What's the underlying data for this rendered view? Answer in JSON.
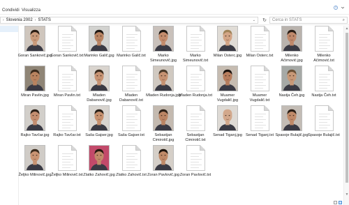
{
  "menu": {
    "share": "Condividi",
    "view": "Visualizza"
  },
  "address": {
    "crumbs": [
      "Slovenia 2002",
      "STATS"
    ],
    "search_placeholder": "Cerca in STATS"
  },
  "colors": {
    "accent": "#4a90d9",
    "selection": "#e5f0fb",
    "border": "#d9d9d9"
  },
  "icons": {
    "refresh": "refresh-icon",
    "search": "search-icon",
    "help": "help-icon",
    "collapse": "chevron-down-icon"
  },
  "files": [
    {
      "name": "Goran Sankovič.jpg",
      "type": "jpg",
      "skin": "#c99a7a",
      "hair": "#2b1d14",
      "bg": "#cfc6bd"
    },
    {
      "name": "Goran Sankovič.txt",
      "type": "txt"
    },
    {
      "name": "Marinko Galič.jpg",
      "type": "jpg",
      "skin": "#b98463",
      "hair": "#1f1712",
      "bg": "#d2d2cf"
    },
    {
      "name": "Marinko Galič.txt",
      "type": "txt"
    },
    {
      "name": "Marko Simeunovič.jpg",
      "type": "jpg",
      "skin": "#c48c6c",
      "hair": "#1b140f",
      "bg": "#c9c1bb"
    },
    {
      "name": "Marko Simeunovič.txt",
      "type": "txt"
    },
    {
      "name": "Milan Osterc.jpg",
      "type": "jpg",
      "skin": "#d3a586",
      "hair": "#a18459",
      "bg": "#e0dcd6"
    },
    {
      "name": "Milan Osterc.txt",
      "type": "txt"
    },
    {
      "name": "Milenko Ačimović.jpg",
      "type": "jpg",
      "skin": "#c0896b",
      "hair": "#2a1d15",
      "bg": "#b9b3ad"
    },
    {
      "name": "Milenko Ačimović.txt",
      "type": "txt"
    },
    {
      "name": "Miran Pavlin.jpg",
      "type": "jpg",
      "skin": "#b8835f",
      "hair": "#3a2a1c",
      "bg": "#8f8576"
    },
    {
      "name": "Miran Pavlin.txt",
      "type": "txt"
    },
    {
      "name": "Mladen Dabanovič.jpg",
      "type": "jpg",
      "skin": "#c79373",
      "hair": "#3b2b1e",
      "bg": "#d9d4ce"
    },
    {
      "name": "Mladen Dabanovič.txt",
      "type": "txt"
    },
    {
      "name": "Mladen Rudonja.jpg",
      "type": "jpg",
      "skin": "#c69272",
      "hair": "#4a3a2a",
      "bg": "#d0c9c1"
    },
    {
      "name": "Mladen Rudonja.txt",
      "type": "txt"
    },
    {
      "name": "Muamer Vugdalič.jpg",
      "type": "jpg",
      "skin": "#b77d5d",
      "hair": "#1b120d",
      "bg": "#c6bcb1"
    },
    {
      "name": "Muamer Vugdalič.txt",
      "type": "txt"
    },
    {
      "name": "Nastja Čeh.jpg",
      "type": "jpg",
      "skin": "#c89877",
      "hair": "#6b5036",
      "bg": "#a6a9a6"
    },
    {
      "name": "Nastja Čeh.txt",
      "type": "txt"
    },
    {
      "name": "Rajko Tavčar.jpg",
      "type": "jpg",
      "skin": "#c48e70",
      "hair": "#2e2119",
      "bg": "#d2cfca"
    },
    {
      "name": "Rajko Tavčar.txt",
      "type": "txt"
    },
    {
      "name": "Saša Gajser.jpg",
      "type": "jpg",
      "skin": "#c7916f",
      "hair": "#2a2018",
      "bg": "#d8d4cf"
    },
    {
      "name": "Saša Gajser.txt",
      "type": "txt"
    },
    {
      "name": "Sebastjan Cimirotič.jpg",
      "type": "jpg",
      "skin": "#bb8564",
      "hair": "#2c2017",
      "bg": "#c4bab0"
    },
    {
      "name": "Sebastjan Cimirotič.txt",
      "type": "txt"
    },
    {
      "name": "Senad Tiganj.jpg",
      "type": "jpg",
      "skin": "#d2a88c",
      "hair": "#d2a88c",
      "bg": "#dedad5"
    },
    {
      "name": "Senad Tiganj.txt",
      "type": "txt"
    },
    {
      "name": "Spasoje Bulajič.jpg",
      "type": "jpg",
      "skin": "#c08a69",
      "hair": "#2a1e16",
      "bg": "#c3bcb5"
    },
    {
      "name": "Spasoje Bulajič.txt",
      "type": "txt"
    },
    {
      "name": "Željko Milinovič.jpg",
      "type": "jpg",
      "skin": "#c99473",
      "hair": "#3d2d1f",
      "bg": "#d0ccc7"
    },
    {
      "name": "Željko Milinovič.txt",
      "type": "txt"
    },
    {
      "name": "Zlatko Zahovič.jpg",
      "type": "jpg",
      "skin": "#c18b6b",
      "hair": "#24190f",
      "bg": "#c24a6a"
    },
    {
      "name": "Zlatko Zahovič.txt",
      "type": "txt"
    },
    {
      "name": "Zoran Pavlovič.jpg",
      "type": "jpg",
      "skin": "#c08a68",
      "hair": "#1e150e",
      "bg": "#d5cfc8"
    },
    {
      "name": "Zoran Pavlovič.txt",
      "type": "txt"
    }
  ]
}
